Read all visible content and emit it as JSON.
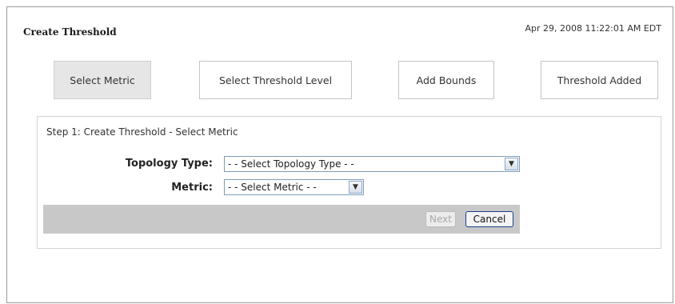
{
  "header": {
    "title": "Create Threshold",
    "timestamp": "Apr 29, 2008 11:22:01 AM EDT"
  },
  "steps": [
    {
      "label": "Select Metric",
      "active": true
    },
    {
      "label": "Select Threshold Level",
      "active": false
    },
    {
      "label": "Add Bounds",
      "active": false
    },
    {
      "label": "Threshold Added",
      "active": false
    }
  ],
  "panel": {
    "header": "Step 1: Create Threshold - Select Metric",
    "topology_label": "Topology Type:",
    "topology_value": "- - Select Topology Type - -",
    "metric_label": "Metric:",
    "metric_value": "- - Select Metric - -"
  },
  "buttons": {
    "next_label": "Next",
    "next_enabled": false,
    "cancel_label": "Cancel"
  },
  "icons": {
    "dropdown": "chevron-down-icon"
  }
}
